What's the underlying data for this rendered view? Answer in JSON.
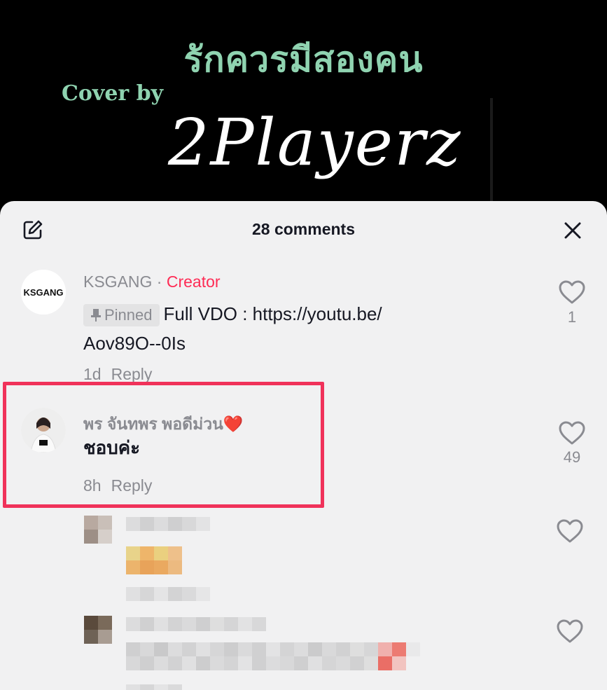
{
  "video": {
    "title_text": "รักควรมีสองคน",
    "cover_text": "Cover by",
    "script_text": "2Playerz"
  },
  "sheet": {
    "title": "28 comments"
  },
  "comments": [
    {
      "username": "KSGANG",
      "separator": " · ",
      "tag": "Creator",
      "pinned_label": "Pinned",
      "text_line1": "Full VDO : https://youtu.be/",
      "text_line2": "Aov89O--0Is",
      "time": "1d",
      "reply_label": "Reply",
      "likes": "1",
      "avatar_logo": "KSGANG"
    },
    {
      "username": "พร จันทพร พอดีม่วน",
      "emoji": "❤️",
      "text": "ชอบค่ะ",
      "time": "8h",
      "reply_label": "Reply",
      "likes": "49"
    }
  ],
  "colors": {
    "accent": "#fe2c55",
    "highlight": "#f0325a",
    "sheet_bg": "#f1f1f2",
    "muted": "#8a8b91"
  },
  "icons": [
    "edit-icon",
    "close-icon",
    "heart-icon",
    "pin-icon"
  ]
}
